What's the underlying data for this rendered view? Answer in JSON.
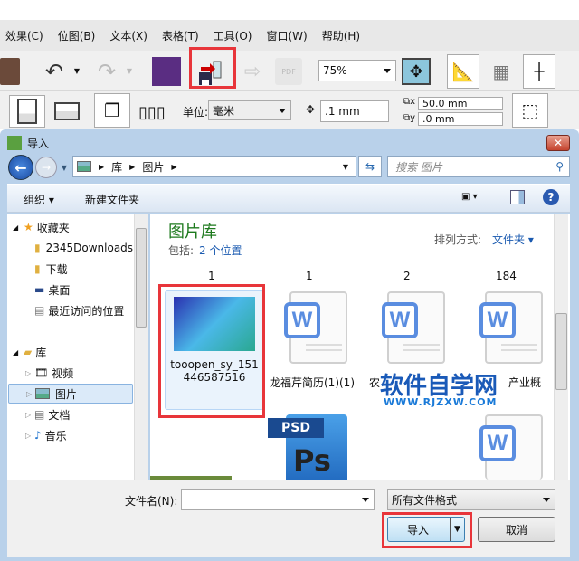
{
  "menu": [
    "效果(C)",
    "位图(B)",
    "文本(X)",
    "表格(T)",
    "工具(O)",
    "窗口(W)",
    "帮助(H)"
  ],
  "toolbar": {
    "zoom": "75%",
    "unit_label": "单位:",
    "unit_value": "毫米",
    "nudge": ".1 mm",
    "dup_x": "50.0 mm",
    "dup_y": ".0 mm",
    "pdf_label": "PDF"
  },
  "dialog": {
    "title": "导入",
    "breadcrumb": [
      "库",
      "图片"
    ],
    "search_placeholder": "搜索 图片",
    "organize": "组织",
    "new_folder": "新建文件夹",
    "nav": {
      "favorites": "收藏夹",
      "fav_items": [
        "2345Downloads",
        "下载",
        "桌面",
        "最近访问的位置"
      ],
      "libraries": "库",
      "lib_items": [
        "视频",
        "图片",
        "文档",
        "音乐"
      ]
    },
    "library_title": "图片库",
    "includes_label": "包括:",
    "includes_link": "2 个位置",
    "arrange_label": "排列方式:",
    "arrange_value": "文件夹",
    "counts": [
      "1",
      "1",
      "2",
      "184"
    ],
    "files": [
      {
        "name1": "tooopen_sy_151",
        "name2": "446587516"
      },
      {
        "name": "龙福芹简历(1)(1)"
      },
      {
        "name": "农"
      },
      {
        "name": "产业概"
      }
    ],
    "psd_label": "PSD",
    "ps_label": "Ps",
    "watermark": "软件自学网",
    "watermark_url": "WWW.RJZXW.COM",
    "filename_label": "文件名(N):",
    "filename_value": "",
    "filetype": "所有文件格式",
    "import_btn": "导入",
    "cancel_btn": "取消"
  }
}
